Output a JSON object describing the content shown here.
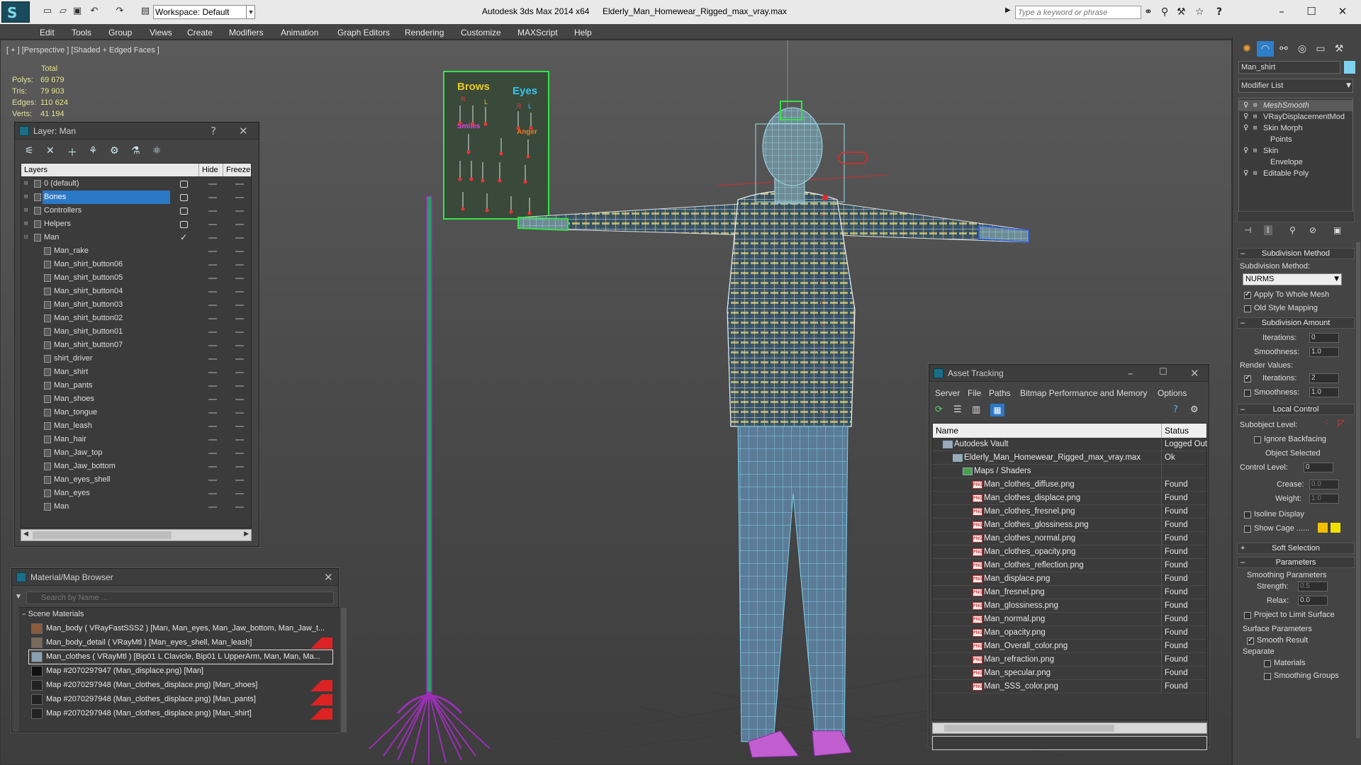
{
  "titlebar": {
    "workspace": "Workspace: Default",
    "app_title": "Autodesk 3ds Max  2014 x64",
    "file_title": "Elderly_Man_Homewear_Rigged_max_vray.max",
    "search_placeholder": "Type a keyword or phrase",
    "help": "?"
  },
  "menu": [
    "Edit",
    "Tools",
    "Group",
    "Views",
    "Create",
    "Modifiers",
    "Animation",
    "Graph Editors",
    "Rendering",
    "Customize",
    "MAXScript",
    "Help"
  ],
  "viewport": {
    "label": "[ + ] [Perspective ] [Shaded + Edged Faces ]",
    "stats": {
      "total": "Total",
      "rows": [
        {
          "label": "Polys:",
          "value": "69 679"
        },
        {
          "label": "Tris:",
          "value": "79 903"
        },
        {
          "label": "Edges:",
          "value": "110 624"
        },
        {
          "label": "Verts:",
          "value": "41 194"
        }
      ]
    },
    "board": {
      "brows": "Brows",
      "eyes": "Eyes",
      "smiles": "Smiles",
      "anger": "Anger",
      "r": "R",
      "l": "L"
    }
  },
  "layer_panel": {
    "title": "Layer: Man",
    "help": "?",
    "close": "✕",
    "headers": {
      "layers": "Layers",
      "hide": "Hide",
      "freeze": "Freeze"
    },
    "rows": [
      {
        "name": "0 (default)",
        "type": "layer"
      },
      {
        "name": "Bones",
        "type": "layer",
        "selected": true
      },
      {
        "name": "Controllers",
        "type": "layer"
      },
      {
        "name": "Helpers",
        "type": "layer"
      },
      {
        "name": "Man",
        "type": "layer",
        "current": true
      },
      {
        "name": "Man_rake",
        "type": "obj"
      },
      {
        "name": "Man_shirt_button06",
        "type": "obj"
      },
      {
        "name": "Man_shirt_button05",
        "type": "obj"
      },
      {
        "name": "Man_shirt_button04",
        "type": "obj"
      },
      {
        "name": "Man_shirt_button03",
        "type": "obj"
      },
      {
        "name": "Man_shirt_button02",
        "type": "obj"
      },
      {
        "name": "Man_shirt_button01",
        "type": "obj"
      },
      {
        "name": "Man_shirt_button07",
        "type": "obj"
      },
      {
        "name": "shirt_driver",
        "type": "obj"
      },
      {
        "name": "Man_shirt",
        "type": "obj"
      },
      {
        "name": "Man_pants",
        "type": "obj"
      },
      {
        "name": "Man_shoes",
        "type": "obj"
      },
      {
        "name": "Man_tongue",
        "type": "obj"
      },
      {
        "name": "Man_leash",
        "type": "obj"
      },
      {
        "name": "Man_hair",
        "type": "obj"
      },
      {
        "name": "Man_Jaw_top",
        "type": "obj"
      },
      {
        "name": "Man_Jaw_bottom",
        "type": "obj"
      },
      {
        "name": "Man_eyes_shell",
        "type": "obj"
      },
      {
        "name": "Man_eyes",
        "type": "obj"
      },
      {
        "name": "Man",
        "type": "obj"
      }
    ]
  },
  "material_browser": {
    "title": "Material/Map Browser",
    "search_placeholder": "Search by Name ...",
    "section": "Scene Materials",
    "rows": [
      "Man_body  ( VRayFastSSS2 ) [Man, Man_eyes, Man_Jaw_bottom, Man_Jaw_t...",
      "Man_body_detail  ( VRayMtl ) [Man_eyes_shell, Man_leash]",
      "Man_clothes  ( VRayMtl ) [Bip01 L Clavicle, Bip01 L UpperArm, Man, Man, Ma...",
      "Map #2070297947 (Man_displace.png) [Man]",
      "Map #2070297948 (Man_clothes_displace.png) [Man_shoes]",
      "Map #2070297948 (Man_clothes_displace.png) [Man_pants]",
      "Map #2070297948 (Man_clothes_displace.png) [Man_shirt]"
    ]
  },
  "asset_tracking": {
    "title": "Asset Tracking",
    "menu": [
      "Server",
      "File",
      "Paths",
      "Bitmap Performance and Memory",
      "Options"
    ],
    "headers": {
      "name": "Name",
      "status": "Status"
    },
    "rows": [
      {
        "name": "Autodesk Vault",
        "status": "Logged Out",
        "level": 1,
        "kind": "vault"
      },
      {
        "name": "Elderly_Man_Homewear_Rigged_max_vray.max",
        "status": "Ok",
        "level": 2,
        "kind": "max"
      },
      {
        "name": "Maps / Shaders",
        "status": "",
        "level": 3,
        "kind": "folder"
      },
      {
        "name": "Man_clothes_diffuse.png",
        "status": "Found",
        "level": 4,
        "kind": "png"
      },
      {
        "name": "Man_clothes_displace.png",
        "status": "Found",
        "level": 4,
        "kind": "png"
      },
      {
        "name": "Man_clothes_fresnel.png",
        "status": "Found",
        "level": 4,
        "kind": "png"
      },
      {
        "name": "Man_clothes_glossiness.png",
        "status": "Found",
        "level": 4,
        "kind": "png"
      },
      {
        "name": "Man_clothes_normal.png",
        "status": "Found",
        "level": 4,
        "kind": "png"
      },
      {
        "name": "Man_clothes_opacity.png",
        "status": "Found",
        "level": 4,
        "kind": "png"
      },
      {
        "name": "Man_clothes_reflection.png",
        "status": "Found",
        "level": 4,
        "kind": "png"
      },
      {
        "name": "Man_displace.png",
        "status": "Found",
        "level": 4,
        "kind": "png"
      },
      {
        "name": "Man_fresnel.png",
        "status": "Found",
        "level": 4,
        "kind": "png"
      },
      {
        "name": "Man_glossiness.png",
        "status": "Found",
        "level": 4,
        "kind": "png"
      },
      {
        "name": "Man_normal.png",
        "status": "Found",
        "level": 4,
        "kind": "png"
      },
      {
        "name": "Man_opacity.png",
        "status": "Found",
        "level": 4,
        "kind": "png"
      },
      {
        "name": "Man_Overall_color.png",
        "status": "Found",
        "level": 4,
        "kind": "png"
      },
      {
        "name": "Man_refraction.png",
        "status": "Found",
        "level": 4,
        "kind": "png"
      },
      {
        "name": "Man_specular.png",
        "status": "Found",
        "level": 4,
        "kind": "png"
      },
      {
        "name": "Man_SSS_color.png",
        "status": "Found",
        "level": 4,
        "kind": "png"
      }
    ]
  },
  "command_panel": {
    "object_name": "Man_shirt",
    "modifier_list": "Modifier List",
    "stack": [
      {
        "name": "MeshSmooth",
        "italic": true
      },
      {
        "name": "VRayDisplacementMod"
      },
      {
        "name": "Skin Morph"
      },
      {
        "name": "Points",
        "sub": true
      },
      {
        "name": "Skin"
      },
      {
        "name": "Envelope",
        "sub": true
      },
      {
        "name": "Editable Poly"
      }
    ],
    "subdivision_method": {
      "header": "Subdivision Method",
      "label": "Subdivision Method:",
      "value": "NURMS",
      "apply_whole": "Apply To Whole Mesh",
      "old_style": "Old Style Mapping"
    },
    "subdivision_amount": {
      "header": "Subdivision Amount",
      "iterations": "Iterations:",
      "iterations_val": "0",
      "smoothness": "Smoothness:",
      "smoothness_val": "1.0",
      "render_values": "Render Values:",
      "r_iterations_val": "2",
      "r_smoothness_val": "1.0"
    },
    "local_control": {
      "header": "Local Control",
      "subobject": "Subobject Level:",
      "ignore_backfacing": "Ignore Backfacing",
      "object_selected": "Object Selected",
      "control_level": "Control Level:",
      "control_level_val": "0",
      "crease": "Crease:",
      "crease_val": "0.0",
      "weight": "Weight:",
      "weight_val": "1.0",
      "isoline": "Isoline Display",
      "show_cage": "Show Cage ......"
    },
    "soft_selection": "Soft Selection",
    "parameters": {
      "header": "Parameters",
      "smoothing": "Smoothing Parameters",
      "strength": "Strength:",
      "strength_val": "0.5",
      "relax": "Relax:",
      "relax_val": "0.0",
      "project": "Project to Limit Surface",
      "surface": "Surface Parameters",
      "smooth_result": "Smooth Result",
      "separate": "Separate",
      "materials": "Materials",
      "smoothing_groups": "Smoothing Groups"
    }
  },
  "colors": {
    "accent": "#2b78c6",
    "wire_cyan": "#7ed2ee",
    "rake": "#9b2fb5",
    "cage_yellow": "#f0c000"
  }
}
